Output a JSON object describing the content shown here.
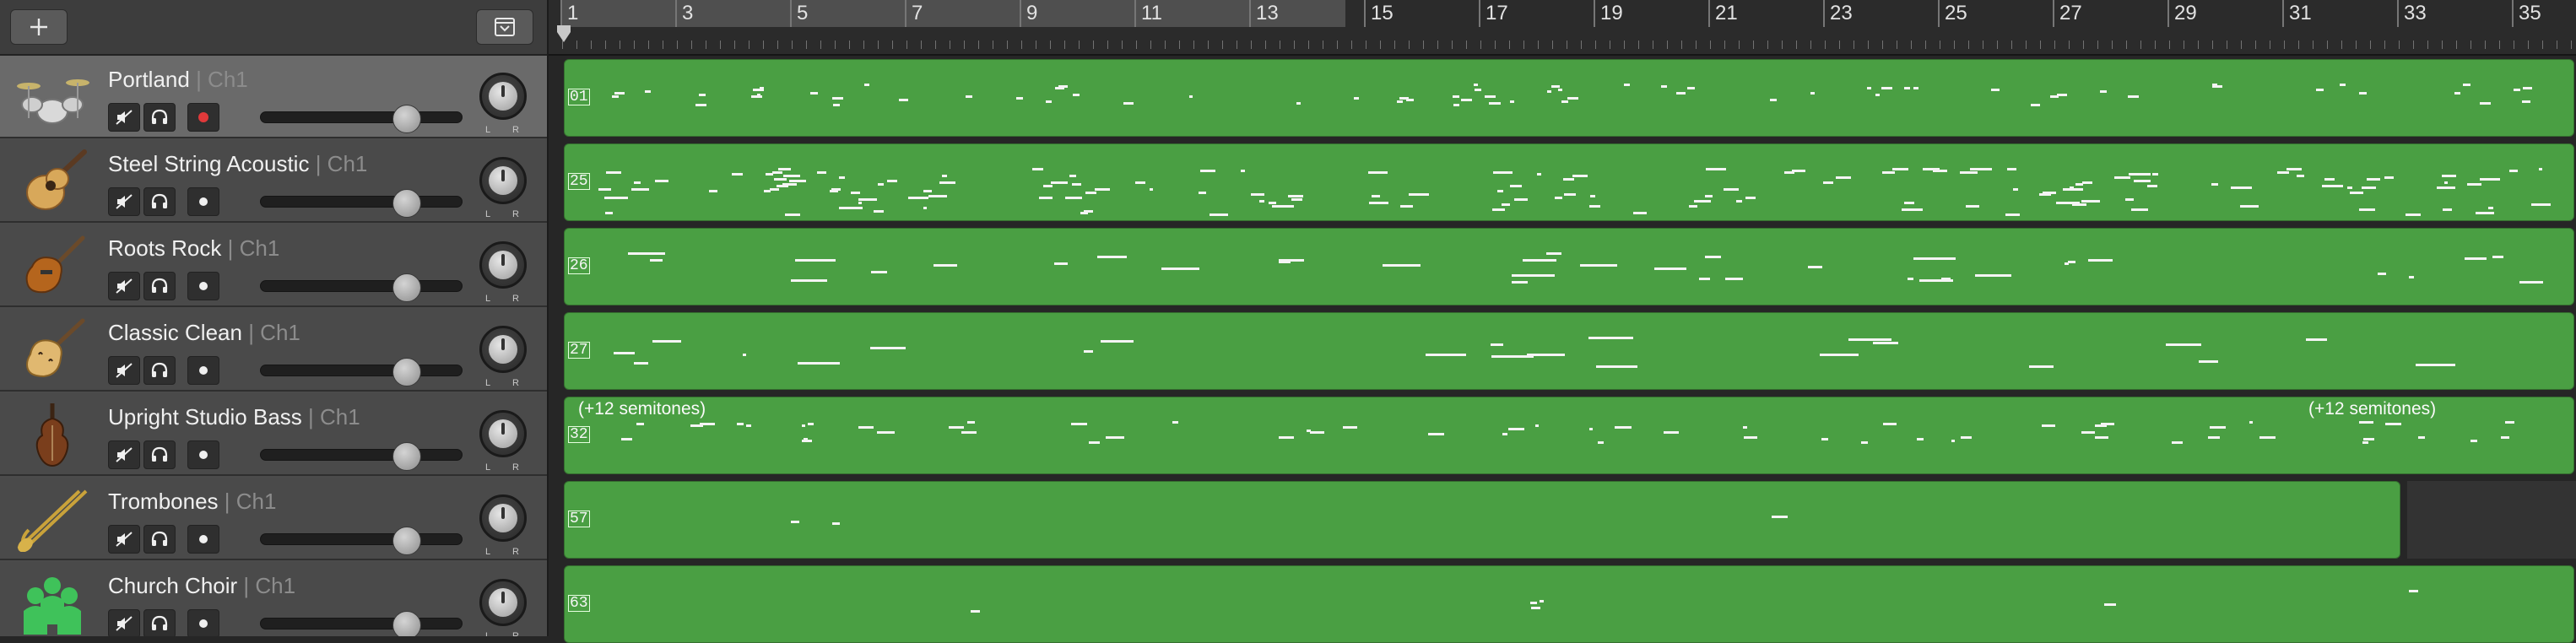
{
  "headers_toolbar": {
    "add_icon": "plus-icon",
    "collapse_icon": "down-chevron-box-icon"
  },
  "ruler": {
    "bars": [
      "1",
      "3",
      "5",
      "7",
      "9",
      "11",
      "13",
      "15",
      "17",
      "19",
      "21",
      "23",
      "25",
      "27",
      "29",
      "31",
      "33",
      "35"
    ]
  },
  "tracks": [
    {
      "name": "Portland",
      "channel": "| Ch1",
      "icon": "drum-kit-icon",
      "selected": true,
      "record_armed": true,
      "volume": 0.72,
      "pan": 0
    },
    {
      "name": "Steel String Acoustic",
      "channel": "| Ch1",
      "icon": "acoustic-guitar-icon",
      "selected": false,
      "record_armed": false,
      "volume": 0.72,
      "pan": 0
    },
    {
      "name": "Roots Rock",
      "channel": "| Ch1",
      "icon": "electric-guitar-icon",
      "selected": false,
      "record_armed": false,
      "volume": 0.72,
      "pan": 0
    },
    {
      "name": "Classic Clean",
      "channel": "| Ch1",
      "icon": "hollow-body-guitar-icon",
      "selected": false,
      "record_armed": false,
      "volume": 0.72,
      "pan": 0
    },
    {
      "name": "Upright Studio Bass",
      "channel": "| Ch1",
      "icon": "upright-bass-icon",
      "selected": false,
      "record_armed": false,
      "volume": 0.72,
      "pan": 0
    },
    {
      "name": "Trombones",
      "channel": "| Ch1",
      "icon": "trombone-icon",
      "selected": false,
      "record_armed": false,
      "volume": 0.72,
      "pan": 0
    },
    {
      "name": "Church Choir",
      "channel": "| Ch1",
      "icon": "choir-icon",
      "selected": false,
      "record_armed": false,
      "volume": 0.72,
      "pan": 0
    }
  ],
  "pan": {
    "left": "L",
    "right": "R"
  },
  "regions": [
    {
      "label": "01",
      "color": "#4a9f43"
    },
    {
      "label": "25",
      "color": "#4a9f43"
    },
    {
      "label": "26",
      "color": "#4a9f43"
    },
    {
      "label": "27",
      "color": "#4a9f43"
    },
    {
      "label": "32",
      "color": "#4a9f43",
      "transpose_left": "(+12 semitones)",
      "transpose_right": "(+12 semitones)"
    },
    {
      "label": "57",
      "color": "#4a9f43"
    },
    {
      "label": "63",
      "color": "#4a9f43"
    }
  ],
  "colors": {
    "region_green": "#4a9f43",
    "record_red": "#e0393a",
    "selected_header": "#6a6a6a"
  }
}
